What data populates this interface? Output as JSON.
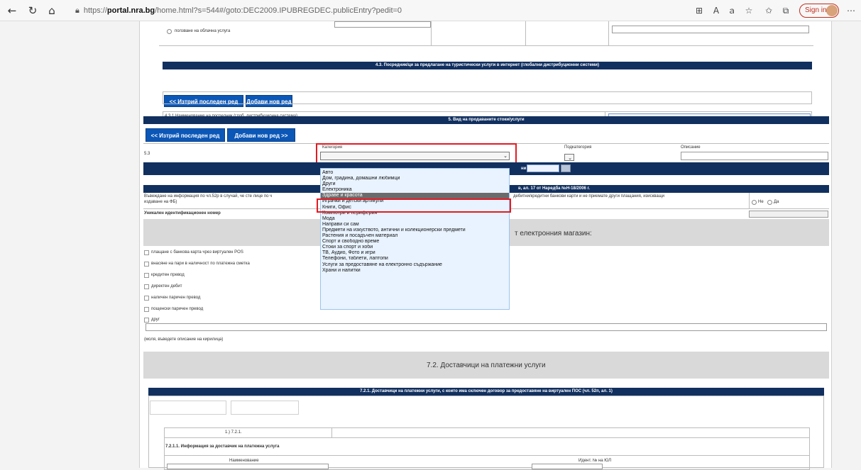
{
  "browser": {
    "url_scheme": "https://",
    "url_host": "portal.nra.bg",
    "url_path": "/home.html?s=544#/goto:DEC2009.IPUBREGDEC.publicEntry?pedit=0",
    "sign_in": "Sign in",
    "icons": [
      "back-icon",
      "refresh-icon",
      "home-icon",
      "lock-icon",
      "split-view-icon",
      "read-aloud-icon",
      "translate-icon",
      "favorite-icon",
      "collections-icon",
      "profile-icon",
      "more-icon"
    ]
  },
  "section_top": {
    "cloud_label": "ползване на облачна услуга"
  },
  "section_4_3": {
    "header": "4.3. Посредник/ци за предлагане на туристически услуги в интернет (глобални дистрибуционни системи)",
    "delete_btn": "<< Изтрий последен ред",
    "add_btn": "Добави нов ред >>",
    "row_label": "4.3.1 Наименование на посредник (глоб. дистрибуционна система)"
  },
  "section_5": {
    "header": "5. Вид на продаваните стоки/услуги",
    "delete_btn": "<< Изтрий последен ред",
    "add_btn": "Добави нов ред >>",
    "row_num": "5.3",
    "col_category": "Категория",
    "col_subcategory": "Подкатегория",
    "col_description": "Описание",
    "fragment_date": "ни"
  },
  "section_6": {
    "header_fragment": "в, ал. 17 от Наредба №Н-18/2006 г.",
    "input_info_a": "Въвеждане на информация по чл.52р в случай, че сте лице по ч",
    "input_info_b": "дебитни/кредитни банкови карти и не приемате други плащания, изискващи",
    "input_info_c": "издаване на ФБ)",
    "radio_no": "Не",
    "radio_yes": "Да",
    "unique_id": "Уникален идентификационен номер"
  },
  "section_7": {
    "header_fragment": "т електронния магазин:",
    "payments": [
      "плащане с банкова карта чрез виртуален POS",
      "внасяне на пари в наличност по платежна сметка",
      "кредитен превод",
      "директен дебит",
      "наличен паричен превод",
      "пощенски паричен превод",
      "друг"
    ],
    "cyrillic_note": "(моля, въведете описание на кирилица)"
  },
  "section_7_2": {
    "header": "7.2. Доставчици на платежни услуги",
    "subheader": "7.2.1. Доставчици на платежни услуги, с които има сключен договор за предоставяне на виртуален ПОС (чл. 52п, ал. 1)",
    "row_number": "1.) 7.2.1.",
    "info_label": "7.2.1.1. Информация за доставчик на платежна услуга",
    "col_name": "Наименование",
    "col_id": "Идент. № на ЮЛ"
  },
  "dropdown": {
    "selected": "Здраве и красота",
    "options": [
      "Авто",
      "Дом, градина, домашни любимци",
      "Други",
      "Електроника",
      "Здраве и красота",
      "Играчки и детски артикули",
      "Книги, Офис",
      "Компютри и периферия",
      "Мода",
      "Направи си сам",
      "Предмети на изкуството, антични и колекционерски предмети",
      "Растения и посадъчен материал",
      "Спорт и свободно време",
      "Стоки за спорт и хоби",
      "ТВ, Аудио, Фото и игри",
      "Телефони, таблети, лаптопи",
      "Услуги за предоставяне на електронно съдържание",
      "Храни и напитки"
    ]
  },
  "colors": {
    "header_bar": "#11305f",
    "button_blue": "#0b57b8",
    "highlight_red": "#e31b23",
    "dropdown_bg": "#e9f3ff",
    "selected_option_bg": "#6b6b6b"
  }
}
